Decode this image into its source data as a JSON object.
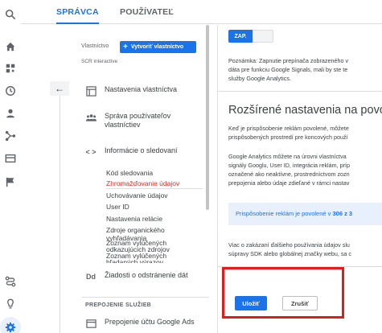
{
  "tabs": [
    {
      "label": "SPRÁVCA",
      "active": true
    },
    {
      "label": "POUŽÍVATEĽ",
      "active": false
    }
  ],
  "rail_icons": [
    "search-icon",
    "home-icon",
    "reports-icon",
    "realtime-icon",
    "user-icon",
    "share-icon",
    "table-icon",
    "flag-icon",
    "route-icon",
    "bulb-icon",
    "settings-icon"
  ],
  "left_panel": {
    "property_label": "Vlastníctvo",
    "create_button": "Vytvoriť vlastníctvo",
    "property_name": "SCR interactive",
    "nav": [
      {
        "label": "Nastavenia vlastníctva",
        "icon": "property-settings-icon"
      },
      {
        "label": "Správa používateľov vlastníctiev",
        "icon": "users-icon"
      },
      {
        "label": "Informácie o sledovaní",
        "icon": "code-icon"
      },
      {
        "label": "Žiadosti o odstránenie dát",
        "icon": "dd-icon"
      },
      {
        "label": "Prepojenie účtu Google Ads",
        "icon": "ads-link-icon"
      }
    ],
    "sub_items": [
      "Kód sledovania",
      "Zhromažďovanie údajov",
      "Uchovávanie údajov",
      "User ID",
      "Nastavenia relácie",
      "Zdroje organického vyhľadávania",
      "Zoznam vylúčených odkazujúcich zdrojov",
      "Zoznam vylúčených hľadaných výrazov"
    ],
    "active_sub": "Zhromažďovanie údajov",
    "dd_icon_text": "Dd",
    "section_heading": "PREPOJENIE SLUŽIEB"
  },
  "content": {
    "toggle_label": "ZAP.",
    "note_lines": [
      "Poznámka: Zapnutie prepínača zobrazeného v",
      "dáta pre funkciu Google Signals, mali by ste te",
      "služby Google Analytics."
    ],
    "heading": "Rozšírené nastavenia na povol",
    "para1": [
      "Keď je prispôsobenie reklám povolené, môžete",
      "prispôsobených prostredí pre koncových použí"
    ],
    "para2": [
      "Google Analytics môžete na úrovni vlastníctva",
      "signály Googlu, User ID, integrácia reklám, príp",
      "označené ako neaktívne, prostredníctvom zozn",
      "prepojenia alebo údaje zdieľané v rámci nastav"
    ],
    "banner_text": "Prispôsobenie reklám je povolené v",
    "banner_bold": "306 z 3",
    "para3": [
      "Viac o zakázaní ďalšieho používania údajov slu",
      "súpravy SDK alebo globálnej značky webu, sa c"
    ],
    "save_button": "Uložiť",
    "cancel_button": "Zrušiť"
  },
  "colors": {
    "accent": "#1a73e8",
    "active_sub": "#d93025",
    "highlight": "#e41b17"
  }
}
